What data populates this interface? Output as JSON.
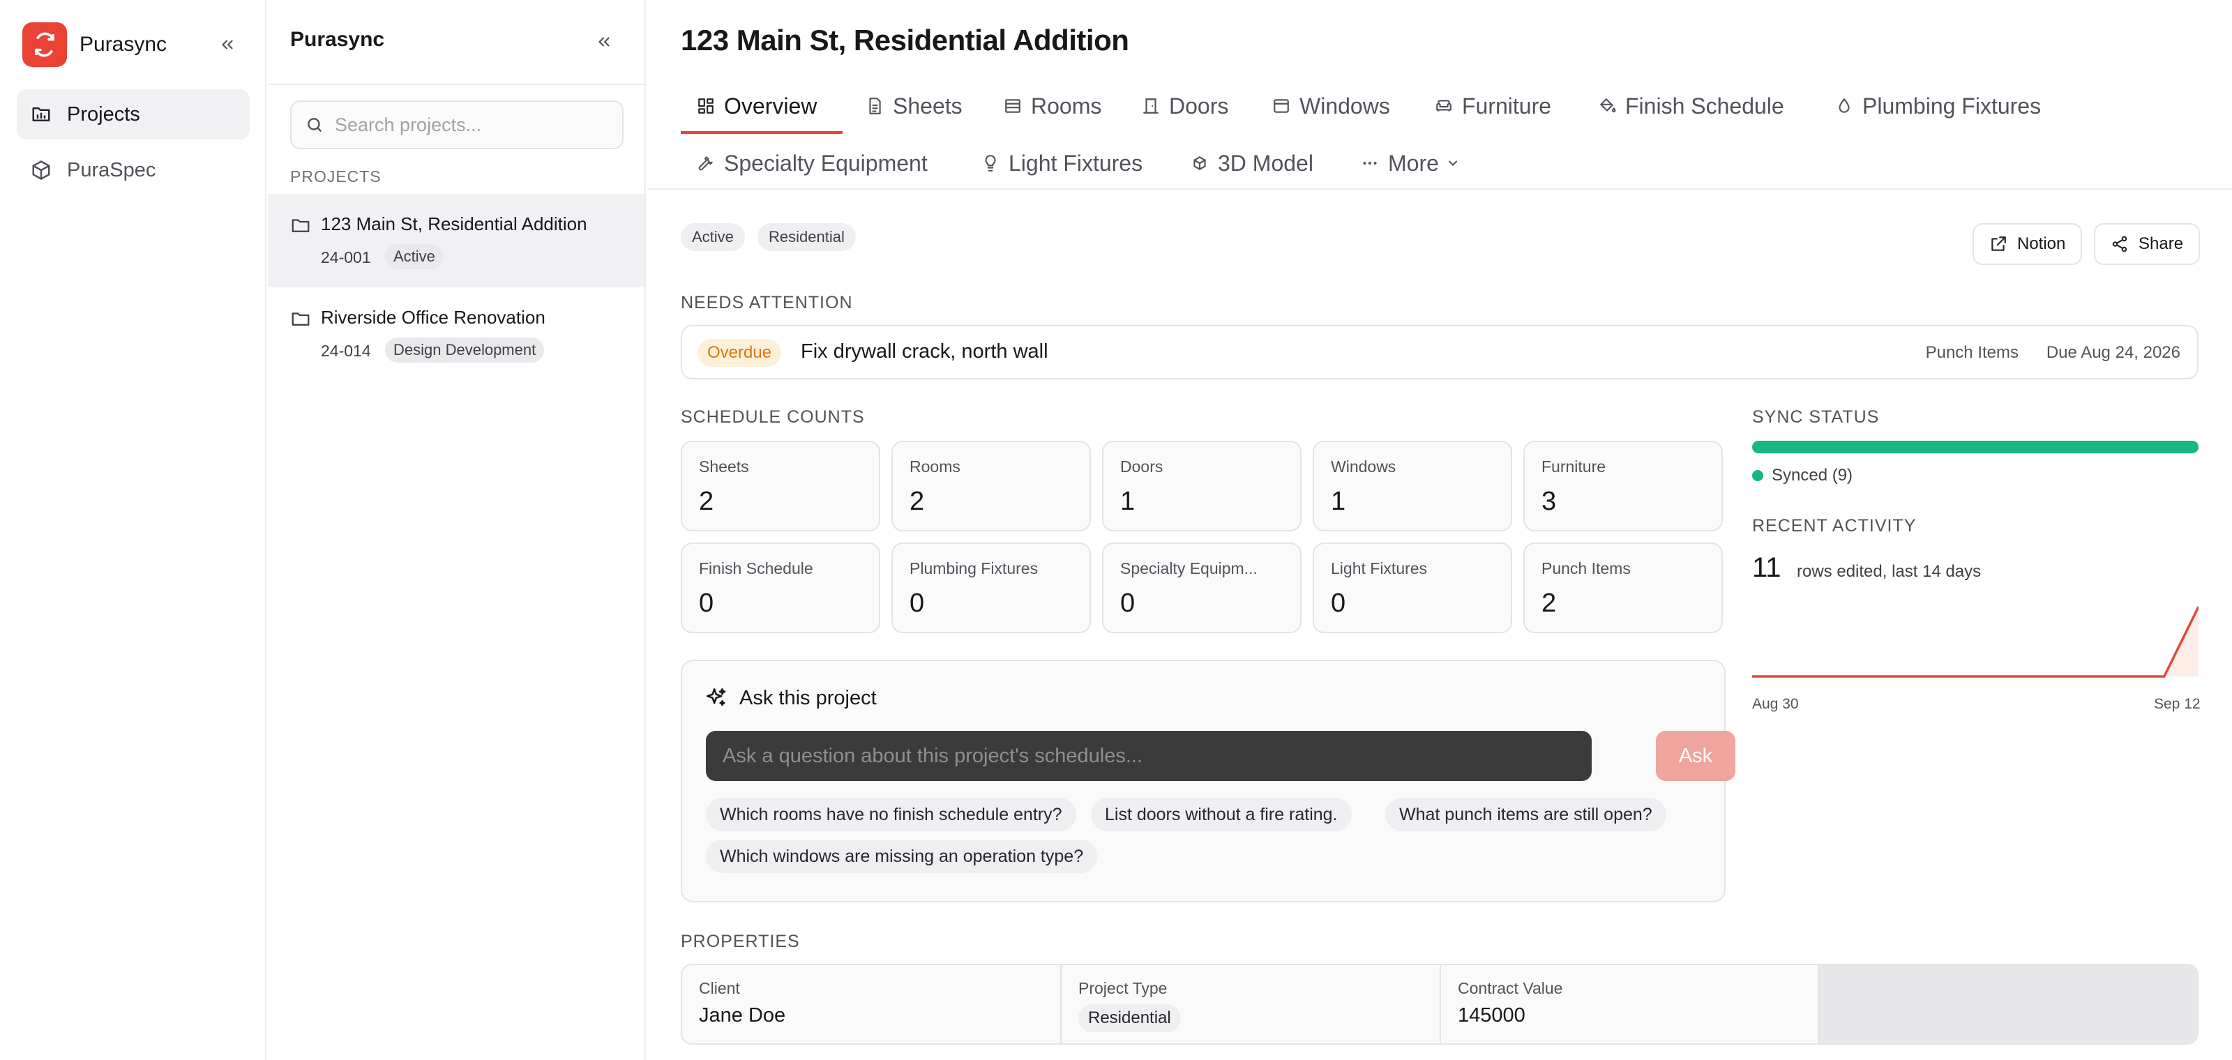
{
  "app": {
    "name": "Purasync",
    "brand_color": "#ea4335"
  },
  "nav": {
    "items": [
      {
        "label": "Projects",
        "icon": "folder-chart-icon",
        "active": true
      },
      {
        "label": "PuraSpec",
        "icon": "cube-icon",
        "active": false
      }
    ]
  },
  "projects_panel": {
    "title": "Purasync",
    "search_placeholder": "Search projects...",
    "section_label": "PROJECTS",
    "projects": [
      {
        "name": "123 Main St, Residential Addition",
        "number": "24-001",
        "status": "Active",
        "selected": true
      },
      {
        "name": "Riverside Office Renovation",
        "number": "24-014",
        "status": "Design Development",
        "selected": false
      }
    ]
  },
  "main": {
    "title": "123 Main St, Residential Addition",
    "tabs": [
      {
        "label": "Overview",
        "icon": "layout-grid-icon"
      },
      {
        "label": "Sheets",
        "icon": "file-text-icon"
      },
      {
        "label": "Rooms",
        "icon": "list-icon"
      },
      {
        "label": "Doors",
        "icon": "door-icon"
      },
      {
        "label": "Windows",
        "icon": "window-icon"
      },
      {
        "label": "Furniture",
        "icon": "sofa-icon"
      },
      {
        "label": "Finish Schedule",
        "icon": "paint-bucket-icon"
      },
      {
        "label": "Plumbing Fixtures",
        "icon": "droplet-icon"
      },
      {
        "label": "Specialty Equipment",
        "icon": "wrench-icon"
      },
      {
        "label": "Light Fixtures",
        "icon": "lightbulb-icon"
      },
      {
        "label": "3D Model",
        "icon": "rotate-3d-icon"
      },
      {
        "label": "More",
        "icon": "ellipsis-icon"
      }
    ],
    "active_tab": "Overview",
    "badges": [
      "Active",
      "Residential"
    ],
    "actions": {
      "notion": "Notion",
      "share": "Share"
    },
    "needs_attention": {
      "label": "NEEDS ATTENTION",
      "status": "Overdue",
      "text": "Fix drywall crack, north wall",
      "source": "Punch Items",
      "due": "Due Aug 24, 2026"
    },
    "schedule_counts": {
      "label": "SCHEDULE COUNTS",
      "items": [
        {
          "label": "Sheets",
          "value": "2"
        },
        {
          "label": "Rooms",
          "value": "2"
        },
        {
          "label": "Doors",
          "value": "1"
        },
        {
          "label": "Windows",
          "value": "1"
        },
        {
          "label": "Furniture",
          "value": "3"
        },
        {
          "label": "Finish Schedule",
          "value": "0"
        },
        {
          "label": "Plumbing Fixtures",
          "value": "0"
        },
        {
          "label": "Specialty Equipm...",
          "value": "0"
        },
        {
          "label": "Light Fixtures",
          "value": "0"
        },
        {
          "label": "Punch Items",
          "value": "2"
        }
      ]
    },
    "sync_status": {
      "label": "SYNC STATUS",
      "text": "Synced (9)",
      "progress": 1.0,
      "color": "#17b77e"
    },
    "recent_activity": {
      "label": "RECENT ACTIVITY",
      "count": "11",
      "text": "rows edited, last 14 days",
      "start_label": "Aug 30",
      "end_label": "Sep 12",
      "daily_values": [
        0,
        0,
        0,
        0,
        0,
        0,
        0,
        0,
        0,
        0,
        0,
        0,
        0,
        11
      ],
      "line_color": "#e5483b"
    },
    "ask": {
      "title": "Ask this project",
      "placeholder": "Ask a question about this project's schedules...",
      "button": "Ask",
      "suggestions": [
        "Which rooms have no finish schedule entry?",
        "List doors without a fire rating.",
        "What punch items are still open?",
        "Which windows are missing an operation type?"
      ]
    },
    "properties": {
      "label": "PROPERTIES",
      "client_label": "Client",
      "client": "Jane Doe",
      "type_label": "Project Type",
      "type": "Residential",
      "value_label": "Contract Value",
      "value": "145000"
    }
  }
}
